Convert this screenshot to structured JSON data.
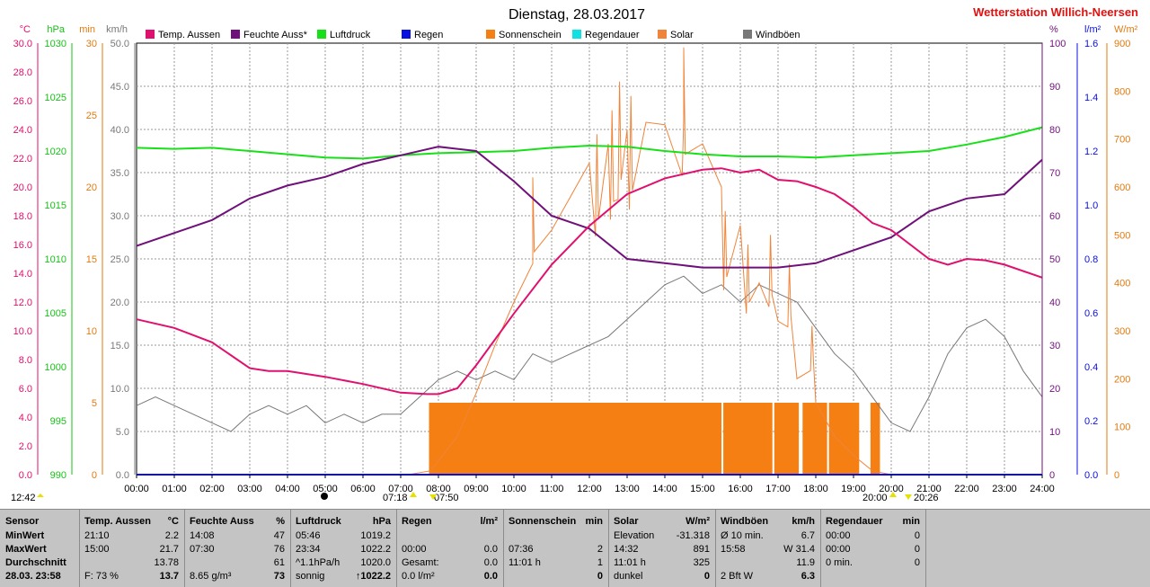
{
  "header": {
    "title": "Dienstag, 28.03.2017",
    "station": "Wetterstation Willich-Neersen"
  },
  "colors": {
    "temp": "#e0106e",
    "humidity": "#70107a",
    "pressure": "#18e018",
    "rain": "#0a10e0",
    "sunshine": "#f57f12",
    "raindur": "#10e0e0",
    "solar": "#f0843a",
    "gust": "#787878",
    "grid": "#9a9a9a"
  },
  "axes_labels": {
    "left": [
      {
        "unit": "°C",
        "color": "#e0106e",
        "ticks": [
          "30.0",
          "28.0",
          "26.0",
          "24.0",
          "22.0",
          "20.0",
          "18.0",
          "16.0",
          "14.0",
          "12.0",
          "10.0",
          "8.0",
          "6.0",
          "4.0",
          "2.0",
          "0.0"
        ]
      },
      {
        "unit": "hPa",
        "color": "#18c018",
        "ticks": [
          "1030",
          "1025",
          "1020",
          "1015",
          "1010",
          "1005",
          "1000",
          "995",
          "990"
        ]
      },
      {
        "unit": "min",
        "color": "#e07a10",
        "ticks": [
          "30",
          "25",
          "20",
          "15",
          "10",
          "5",
          "0"
        ]
      },
      {
        "unit": "km/h",
        "color": "#787878",
        "ticks": [
          "50.0",
          "45.0",
          "40.0",
          "35.0",
          "30.0",
          "25.0",
          "20.0",
          "15.0",
          "10.0",
          "5.0",
          "0.0"
        ]
      }
    ],
    "right": [
      {
        "unit": "%",
        "color": "#70107a",
        "ticks": [
          "100",
          "90",
          "80",
          "70",
          "60",
          "50",
          "40",
          "30",
          "20",
          "10",
          "0"
        ]
      },
      {
        "unit": "l/m²",
        "color": "#0a10e0",
        "ticks": [
          "1.6",
          "1.4",
          "1.2",
          "1.0",
          "0.8",
          "0.6",
          "0.4",
          "0.2",
          "0.0"
        ]
      },
      {
        "unit": "W/m²",
        "color": "#e07a10",
        "ticks": [
          "900",
          "800",
          "700",
          "600",
          "500",
          "400",
          "300",
          "200",
          "100",
          "0"
        ]
      }
    ],
    "time_ticks": [
      "00:00",
      "01:00",
      "02:00",
      "03:00",
      "04:00",
      "05:00",
      "06:00",
      "07:00",
      "08:00",
      "09:00",
      "10:00",
      "11:00",
      "12:00",
      "13:00",
      "14:00",
      "15:00",
      "16:00",
      "17:00",
      "18:00",
      "19:00",
      "20:00",
      "21:00",
      "22:00",
      "23:00",
      "24:00"
    ]
  },
  "legend": [
    {
      "label": "Temp. Aussen",
      "color": "#e0106e"
    },
    {
      "label": "Feuchte Auss*",
      "color": "#70107a"
    },
    {
      "label": "Luftdruck",
      "color": "#18e018"
    },
    {
      "label": "Regen",
      "color": "#0a10e0"
    },
    {
      "label": "Sonnenschein",
      "color": "#f57f12"
    },
    {
      "label": "Regendauer",
      "color": "#10e0e0"
    },
    {
      "label": "Solar",
      "color": "#f0843a"
    },
    {
      "label": "Windböen",
      "color": "#787878"
    }
  ],
  "markers": {
    "moonrise": "12:42",
    "sunrise_a": "07:18",
    "sunrise_b": "07:50",
    "sunset_a": "20:00",
    "sunset_b": "20:26"
  },
  "chart_data": {
    "type": "line",
    "x_unit": "hours",
    "x_range": [
      0,
      24
    ],
    "series": [
      {
        "name": "Temp. Aussen",
        "unit": "°C",
        "y_range": [
          0,
          30
        ],
        "points": [
          [
            0,
            10.8
          ],
          [
            1,
            10.2
          ],
          [
            2,
            9.2
          ],
          [
            3,
            7.4
          ],
          [
            3.5,
            7.2
          ],
          [
            4,
            7.2
          ],
          [
            5,
            6.8
          ],
          [
            6,
            6.3
          ],
          [
            7,
            5.7
          ],
          [
            7.7,
            5.6
          ],
          [
            8,
            5.6
          ],
          [
            8.5,
            6.0
          ],
          [
            9,
            7.6
          ],
          [
            10,
            11.2
          ],
          [
            11,
            14.6
          ],
          [
            12,
            17.3
          ],
          [
            13,
            19.5
          ],
          [
            14,
            20.6
          ],
          [
            15,
            21.2
          ],
          [
            15.5,
            21.3
          ],
          [
            16,
            21.0
          ],
          [
            16.5,
            21.2
          ],
          [
            17,
            20.5
          ],
          [
            17.5,
            20.4
          ],
          [
            18,
            20.0
          ],
          [
            18.5,
            19.5
          ],
          [
            19,
            18.6
          ],
          [
            19.5,
            17.5
          ],
          [
            20,
            17.0
          ],
          [
            21,
            15.0
          ],
          [
            21.5,
            14.6
          ],
          [
            22,
            15.0
          ],
          [
            22.5,
            14.9
          ],
          [
            23,
            14.6
          ],
          [
            24,
            13.7
          ]
        ]
      },
      {
        "name": "Feuchte Auss*",
        "unit": "%",
        "y_range": [
          0,
          100
        ],
        "points": [
          [
            0,
            53
          ],
          [
            1,
            56
          ],
          [
            2,
            59
          ],
          [
            3,
            64
          ],
          [
            4,
            67
          ],
          [
            5,
            69
          ],
          [
            6,
            72
          ],
          [
            7,
            74
          ],
          [
            8,
            76
          ],
          [
            9,
            75
          ],
          [
            10,
            68
          ],
          [
            11,
            60
          ],
          [
            12,
            57
          ],
          [
            13,
            50
          ],
          [
            14,
            49
          ],
          [
            15,
            48
          ],
          [
            16,
            48
          ],
          [
            17,
            48
          ],
          [
            18,
            49
          ],
          [
            19,
            52
          ],
          [
            20,
            55
          ],
          [
            21,
            61
          ],
          [
            22,
            64
          ],
          [
            23,
            65
          ],
          [
            24,
            73
          ]
        ]
      },
      {
        "name": "Luftdruck",
        "unit": "hPa",
        "y_range": [
          990,
          1030
        ],
        "points": [
          [
            0,
            1020.3
          ],
          [
            1,
            1020.2
          ],
          [
            2,
            1020.3
          ],
          [
            3,
            1020.0
          ],
          [
            4,
            1019.7
          ],
          [
            5,
            1019.4
          ],
          [
            6,
            1019.3
          ],
          [
            7,
            1019.6
          ],
          [
            8,
            1019.8
          ],
          [
            9,
            1019.9
          ],
          [
            10,
            1020.0
          ],
          [
            11,
            1020.3
          ],
          [
            12,
            1020.5
          ],
          [
            13,
            1020.4
          ],
          [
            14,
            1020.0
          ],
          [
            15,
            1019.7
          ],
          [
            16,
            1019.5
          ],
          [
            17,
            1019.5
          ],
          [
            18,
            1019.4
          ],
          [
            19,
            1019.6
          ],
          [
            20,
            1019.8
          ],
          [
            21,
            1020.0
          ],
          [
            22,
            1020.6
          ],
          [
            23,
            1021.3
          ],
          [
            24,
            1022.2
          ]
        ]
      },
      {
        "name": "Solar",
        "unit": "W/m²",
        "y_range": [
          0,
          900
        ],
        "points": [
          [
            7.2,
            0
          ],
          [
            7.8,
            8
          ],
          [
            8.5,
            80
          ],
          [
            9,
            170
          ],
          [
            9.5,
            270
          ],
          [
            10,
            360
          ],
          [
            10.5,
            440
          ],
          [
            11,
            510
          ],
          [
            11.5,
            580
          ],
          [
            12,
            650
          ],
          [
            12.5,
            690
          ],
          [
            13,
            720
          ],
          [
            13.5,
            735
          ],
          [
            14,
            730
          ],
          [
            14.5,
            740
          ],
          [
            15,
            690
          ],
          [
            15.5,
            600
          ],
          [
            16,
            520
          ],
          [
            16.5,
            400
          ],
          [
            17,
            320
          ],
          [
            17.5,
            200
          ],
          [
            18,
            150
          ],
          [
            18.5,
            80
          ],
          [
            19,
            40
          ],
          [
            19.5,
            8
          ],
          [
            20,
            0
          ]
        ],
        "spikes": [
          [
            10.5,
            620
          ],
          [
            12.2,
            710
          ],
          [
            12.6,
            760
          ],
          [
            12.8,
            820
          ],
          [
            13.1,
            790
          ],
          [
            14.5,
            891
          ],
          [
            15.6,
            550
          ],
          [
            16.2,
            480
          ],
          [
            16.8,
            500
          ],
          [
            17.3,
            440
          ],
          [
            17.9,
            310
          ]
        ]
      },
      {
        "name": "Windböen",
        "unit": "km/h",
        "y_range": [
          0,
          50
        ],
        "points": [
          [
            0,
            8
          ],
          [
            0.5,
            9
          ],
          [
            1,
            8
          ],
          [
            1.5,
            7
          ],
          [
            2,
            6
          ],
          [
            2.5,
            5
          ],
          [
            3,
            7
          ],
          [
            3.5,
            8
          ],
          [
            4,
            7
          ],
          [
            4.5,
            8
          ],
          [
            5,
            6
          ],
          [
            5.5,
            7
          ],
          [
            6,
            6
          ],
          [
            6.5,
            7
          ],
          [
            7,
            7
          ],
          [
            7.5,
            9
          ],
          [
            8,
            11
          ],
          [
            8.5,
            12
          ],
          [
            9,
            11
          ],
          [
            9.5,
            12
          ],
          [
            10,
            11
          ],
          [
            10.5,
            14
          ],
          [
            11,
            13
          ],
          [
            11.5,
            14
          ],
          [
            12,
            15
          ],
          [
            12.5,
            16
          ],
          [
            13,
            18
          ],
          [
            13.5,
            20
          ],
          [
            14,
            22
          ],
          [
            14.5,
            23
          ],
          [
            15,
            21
          ],
          [
            15.5,
            22
          ],
          [
            16,
            20
          ],
          [
            16.5,
            22
          ],
          [
            17,
            21
          ],
          [
            17.5,
            20
          ],
          [
            18,
            17
          ],
          [
            18.5,
            14
          ],
          [
            19,
            12
          ],
          [
            19.5,
            9
          ],
          [
            20,
            6
          ],
          [
            20.5,
            5
          ],
          [
            21,
            9
          ],
          [
            21.5,
            14
          ],
          [
            22,
            17
          ],
          [
            22.5,
            18
          ],
          [
            23,
            16
          ],
          [
            23.5,
            12
          ],
          [
            24,
            9
          ]
        ]
      },
      {
        "name": "Regen",
        "unit": "l/m²",
        "y_range": [
          0,
          1.6
        ],
        "points": [
          [
            0,
            0
          ],
          [
            24,
            0
          ]
        ]
      }
    ],
    "sunshine_bars": [
      [
        7.75,
        15.5
      ],
      [
        15.55,
        16.85
      ],
      [
        16.9,
        17.55
      ],
      [
        17.65,
        18.3
      ],
      [
        18.35,
        19.15
      ],
      [
        19.45,
        19.7
      ]
    ],
    "sunshine_height_min": 5
  },
  "stats": {
    "cols": [
      {
        "title": "Sensor",
        "unit": "",
        "rows": [
          [
            "MinWert",
            "",
            ""
          ],
          [
            "MaxWert",
            "",
            ""
          ],
          [
            "Durchschnitt",
            "",
            ""
          ],
          [
            "28.03. 23:58",
            "",
            ""
          ]
        ]
      },
      {
        "title": "Temp. Aussen",
        "unit": "°C",
        "rows": [
          [
            "21:10",
            "",
            "2.2"
          ],
          [
            "15:00",
            "",
            "21.7"
          ],
          [
            "",
            "",
            "13.78"
          ],
          [
            "F: 73 %",
            "",
            "13.7"
          ]
        ]
      },
      {
        "title": "Feuchte Auss",
        "unit": "%",
        "rows": [
          [
            "14:08",
            "",
            "47"
          ],
          [
            "07:30",
            "",
            "76"
          ],
          [
            "",
            "",
            "61"
          ],
          [
            "8.65 g/m³",
            "",
            "73"
          ]
        ]
      },
      {
        "title": "Luftdruck",
        "unit": "hPa",
        "rows": [
          [
            "05:46",
            "",
            "1019.2"
          ],
          [
            "23:34",
            "",
            "1022.2"
          ],
          [
            "^1.1hPa/h",
            "",
            "1020.0"
          ],
          [
            "sonnig",
            "",
            "↑1022.2"
          ]
        ]
      },
      {
        "title": "Regen",
        "unit": "l/m²",
        "rows": [
          [
            "",
            "",
            ""
          ],
          [
            "00:00",
            "",
            "0.0"
          ],
          [
            "Gesamt:",
            "",
            "0.0"
          ],
          [
            "0.0 l/m²",
            "",
            "0.0"
          ]
        ]
      },
      {
        "title": "Sonnenschein",
        "unit": "min",
        "rows": [
          [
            "",
            "",
            ""
          ],
          [
            "07:36",
            "",
            "2"
          ],
          [
            "11:01 h",
            "",
            "1"
          ],
          [
            "",
            "",
            "0"
          ]
        ]
      },
      {
        "title": "Solar",
        "unit": "W/m²",
        "rows": [
          [
            "Elevation",
            "",
            "-31.318"
          ],
          [
            "14:32",
            "",
            "891"
          ],
          [
            "11:01 h",
            "",
            "325"
          ],
          [
            "dunkel",
            "",
            "0"
          ]
        ]
      },
      {
        "title": "Windböen",
        "unit": "km/h",
        "rows": [
          [
            "Ø 10 min.",
            "",
            "6.7"
          ],
          [
            "15:58",
            "",
            "W 31.4"
          ],
          [
            "",
            "",
            "11.9"
          ],
          [
            "2 Bft W",
            "",
            "6.3"
          ]
        ]
      },
      {
        "title": "Regendauer",
        "unit": "min",
        "rows": [
          [
            "00:00",
            "",
            "0"
          ],
          [
            "00:00",
            "",
            "0"
          ],
          [
            "0 min.",
            "",
            "0"
          ],
          [
            "",
            "",
            ""
          ]
        ]
      }
    ]
  }
}
